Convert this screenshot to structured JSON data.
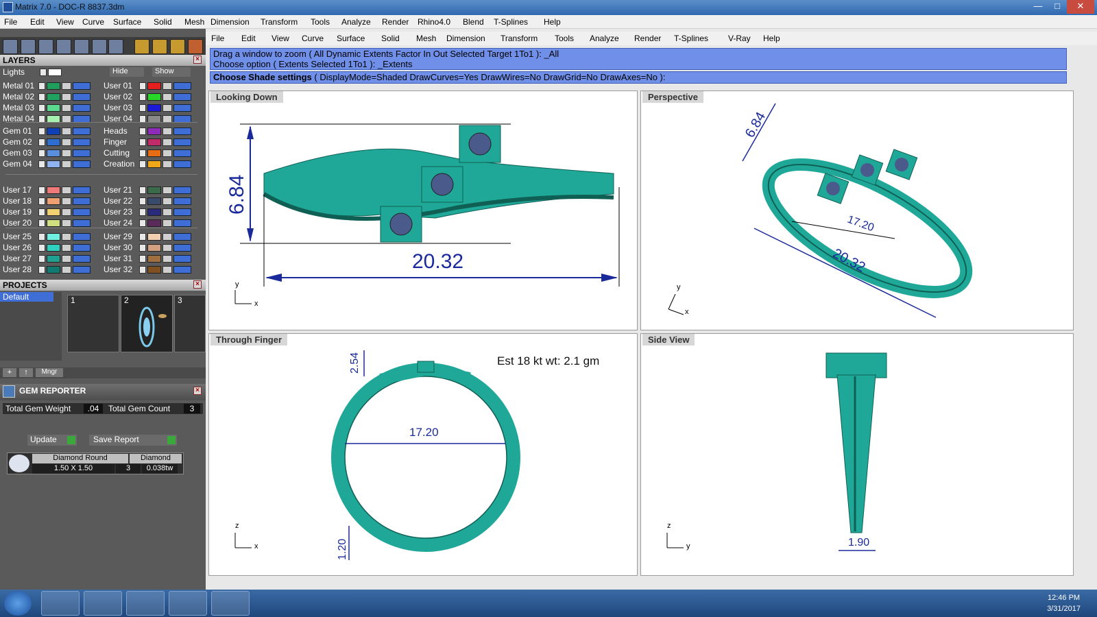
{
  "window": {
    "title": "Matrix 7.0 - DOC-R 8837.3dm"
  },
  "menu1": [
    "File",
    "Edit",
    "View",
    "Curve",
    "Surface",
    "Solid",
    "Mesh",
    "Dimension",
    "Transform",
    "Tools",
    "Analyze",
    "Render",
    "Rhino4.0",
    "Blend",
    "T-Splines",
    "Help"
  ],
  "menu2": [
    "File",
    "Edit",
    "View",
    "Curve",
    "Surface",
    "Solid",
    "Mesh",
    "Dimension",
    "Transform",
    "Tools",
    "Analyze",
    "Render",
    "T-Splines",
    "V-Ray",
    "Help"
  ],
  "command": {
    "line1": "Drag a window to zoom ( All  Dynamic  Extents  Factor  In  Out  Selected  Target  1To1 ): _All",
    "line2": "Choose option ( Extents  Selected  1To1 ): _Extents",
    "prompt_bold": "Choose Shade settings",
    "prompt_rest": "( DisplayMode=Shaded  DrawCurves=Yes  DrawWires=No  DrawGrid=No  DrawAxes=No ):"
  },
  "layers": {
    "title": "LAYERS",
    "lights": "Lights",
    "hide": "Hide",
    "show": "Show",
    "left_group1": [
      {
        "name": "Metal 01",
        "color": "#1e9e5a"
      },
      {
        "name": "Metal 02",
        "color": "#1fa35f"
      },
      {
        "name": "Metal 03",
        "color": "#5bd98f"
      },
      {
        "name": "Metal 04",
        "color": "#a6f0b0"
      }
    ],
    "right_group1": [
      {
        "name": "User 01",
        "color": "#e51e1e"
      },
      {
        "name": "User 02",
        "color": "#27d627"
      },
      {
        "name": "User 03",
        "color": "#1a1ad8"
      },
      {
        "name": "User 04",
        "color": "#8a8a8a"
      }
    ],
    "left_group2": [
      {
        "name": "Gem 01",
        "color": "#1040b8"
      },
      {
        "name": "Gem 02",
        "color": "#2e6ed0"
      },
      {
        "name": "Gem 03",
        "color": "#5a8fe0"
      },
      {
        "name": "Gem 04",
        "color": "#8fb3ee"
      }
    ],
    "right_group2": [
      {
        "name": "Heads",
        "color": "#8e2cb8"
      },
      {
        "name": "Finger",
        "color": "#c02c6a"
      },
      {
        "name": "Cutting",
        "color": "#e66d14"
      },
      {
        "name": "Creation",
        "color": "#f0a81a"
      }
    ],
    "left_group3": [
      {
        "name": "User 17",
        "color": "#f07a7a"
      },
      {
        "name": "User 18",
        "color": "#f0a070"
      },
      {
        "name": "User 19",
        "color": "#f0d070"
      },
      {
        "name": "User 20",
        "color": "#d0e080"
      }
    ],
    "right_group3": [
      {
        "name": "User 21",
        "color": "#3a6a4a"
      },
      {
        "name": "User 22",
        "color": "#3a4a6a"
      },
      {
        "name": "User 23",
        "color": "#2a2a7a"
      },
      {
        "name": "User 24",
        "color": "#5a2a5a"
      }
    ],
    "left_group4": [
      {
        "name": "User 25",
        "color": "#70f0e0"
      },
      {
        "name": "User 26",
        "color": "#30d0c0"
      },
      {
        "name": "User 27",
        "color": "#20a090"
      },
      {
        "name": "User 28",
        "color": "#107a70"
      }
    ],
    "right_group4": [
      {
        "name": "User 29",
        "color": "#f0d0b0"
      },
      {
        "name": "User 30",
        "color": "#d0a080"
      },
      {
        "name": "User 31",
        "color": "#a07040"
      },
      {
        "name": "User 32",
        "color": "#805020"
      }
    ]
  },
  "projects": {
    "title": "PROJECTS",
    "default": "Default",
    "slots": [
      "1",
      "2",
      "3"
    ],
    "mngr": "Mngr"
  },
  "gem_reporter": {
    "title": "GEM REPORTER",
    "weight_label": "Total Gem Weight",
    "weight_value": ".04",
    "count_label": "Total Gem Count",
    "count_value": "3",
    "update": "Update",
    "save": "Save Report",
    "row": {
      "shape": "Diamond Round",
      "type": "Diamond",
      "size": "1.50 X 1.50",
      "qty": "3",
      "weight": "0.038tw"
    }
  },
  "viewports": {
    "top": {
      "label": "Looking Down",
      "dim_h": "6.84",
      "dim_w": "20.32",
      "ax1": "y",
      "ax2": "x"
    },
    "persp": {
      "label": "Perspective",
      "dim1": "6.84",
      "dim2": "17.20",
      "dim3": "20.32",
      "ax1": "y",
      "ax2": "x"
    },
    "front": {
      "label": "Through Finger",
      "dim_top": "2.54",
      "dim_inner": "17.20",
      "dim_bot": "1.20",
      "note": "Est 18 kt wt: 2.1 gm",
      "ax1": "z",
      "ax2": "x"
    },
    "side": {
      "label": "Side View",
      "dim": "1.90",
      "ax1": "z",
      "ax2": "y"
    }
  },
  "colors": {
    "ring": "#1fa898",
    "ring_dark": "#0f5f55",
    "dim": "#1a2a9a",
    "gem": "#4a5a8a"
  },
  "taskbar": {
    "time": "12:46 PM",
    "date": "3/31/2017"
  }
}
